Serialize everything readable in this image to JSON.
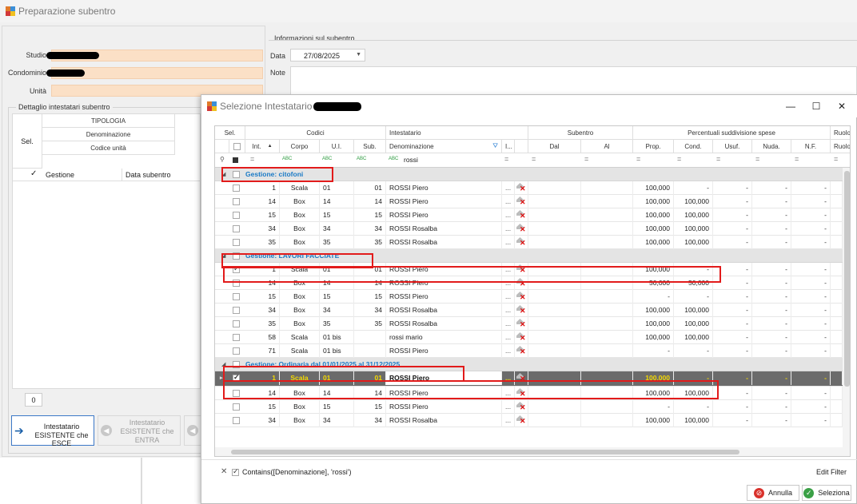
{
  "parent": {
    "title": "Preparazione subentro",
    "labels": {
      "studio": "Studio",
      "condominio": "Condominio",
      "unita": "Unità"
    },
    "info": {
      "section_title": "Informazioni sul subentro",
      "data_label": "Data",
      "data_value": "27/08/2025",
      "note_label": "Note"
    },
    "dettaglio": {
      "section_title": "Dettaglio intestatari subentro",
      "sel_header": "Sel.",
      "sub_headers": [
        "TIPOLOGIA",
        "Denominazione",
        "Codice unità"
      ],
      "col_gestione": "Gestione",
      "col_data_subentro": "Data subentro",
      "count": "0"
    },
    "buttons": {
      "esce_line1": "Intestatario",
      "esce_line2": "ESISTENTE che ESCE",
      "entra_line1": "Intestatario",
      "entra_line2": "ESISTENTE che",
      "entra_line3": "ENTRA"
    }
  },
  "modal": {
    "title": "Selezione Intestatario",
    "window_buttons": {
      "minimize": "—",
      "maximize": "☐",
      "close": "✕"
    },
    "bands": {
      "sel": "Sel.",
      "codici": "Codici",
      "intestatario": "Intestatario",
      "subentro": "Subentro",
      "percentuali": "Percentuali suddivisione spese",
      "ruolo": "Ruolo"
    },
    "columns": {
      "int": "Int.",
      "corpo": "Corpo",
      "ui": "U.I.",
      "sub": "Sub.",
      "denominazione": "Denominazione",
      "i": "I...",
      "dal": "Dal",
      "al": "Al",
      "prop": "Prop.",
      "cond": "Cond.",
      "usuf": "Usuf.",
      "nuda": "Nuda.",
      "nf": "N.F.",
      "ruolo": "Ruolo"
    },
    "filter_row": {
      "eq": "=",
      "abc": "ABC",
      "denominazione_filter": "rossi"
    },
    "groups": [
      {
        "title": "Gestione: citofoni",
        "rows": [
          {
            "int": "1",
            "corpo": "Scala",
            "ui": "01",
            "sub": "01",
            "den": "ROSSI Piero",
            "prop": "100,000",
            "cond": "-",
            "usuf": "-",
            "nuda": "-",
            "nf": "-",
            "checked": false
          },
          {
            "int": "14",
            "corpo": "Box",
            "ui": "14",
            "sub": "14",
            "den": "ROSSI Piero",
            "prop": "100,000",
            "cond": "100,000",
            "usuf": "-",
            "nuda": "-",
            "nf": "-",
            "checked": false
          },
          {
            "int": "15",
            "corpo": "Box",
            "ui": "15",
            "sub": "15",
            "den": "ROSSI Piero",
            "prop": "100,000",
            "cond": "100,000",
            "usuf": "-",
            "nuda": "-",
            "nf": "-",
            "checked": false
          },
          {
            "int": "34",
            "corpo": "Box",
            "ui": "34",
            "sub": "34",
            "den": "ROSSI Rosalba",
            "prop": "100,000",
            "cond": "100,000",
            "usuf": "-",
            "nuda": "-",
            "nf": "-",
            "checked": false
          },
          {
            "int": "35",
            "corpo": "Box",
            "ui": "35",
            "sub": "35",
            "den": "ROSSI Rosalba",
            "prop": "100,000",
            "cond": "100,000",
            "usuf": "-",
            "nuda": "-",
            "nf": "-",
            "checked": false
          }
        ]
      },
      {
        "title": "Gestione: LAVORI FACCIATE",
        "rows": [
          {
            "int": "1",
            "corpo": "Scala",
            "ui": "01",
            "sub": "01",
            "den": "ROSSI Piero",
            "prop": "100,000",
            "cond": "-",
            "usuf": "-",
            "nuda": "-",
            "nf": "-",
            "checked": true
          },
          {
            "int": "14",
            "corpo": "Box",
            "ui": "14",
            "sub": "14",
            "den": "ROSSI Piero",
            "prop": "50,000",
            "cond": "50,000",
            "usuf": "-",
            "nuda": "-",
            "nf": "-",
            "checked": false
          },
          {
            "int": "15",
            "corpo": "Box",
            "ui": "15",
            "sub": "15",
            "den": "ROSSI Piero",
            "prop": "-",
            "cond": "-",
            "usuf": "-",
            "nuda": "-",
            "nf": "-",
            "checked": false
          },
          {
            "int": "34",
            "corpo": "Box",
            "ui": "34",
            "sub": "34",
            "den": "ROSSI Rosalba",
            "prop": "100,000",
            "cond": "100,000",
            "usuf": "-",
            "nuda": "-",
            "nf": "-",
            "checked": false
          },
          {
            "int": "35",
            "corpo": "Box",
            "ui": "35",
            "sub": "35",
            "den": "ROSSI Rosalba",
            "prop": "100,000",
            "cond": "100,000",
            "usuf": "-",
            "nuda": "-",
            "nf": "-",
            "checked": false
          },
          {
            "int": "58",
            "corpo": "Scala",
            "ui": "01 bis",
            "sub": "",
            "den": "rossi mario",
            "prop": "100,000",
            "cond": "100,000",
            "usuf": "-",
            "nuda": "-",
            "nf": "-",
            "checked": false
          },
          {
            "int": "71",
            "corpo": "Scala",
            "ui": "01 bis",
            "sub": "",
            "den": "ROSSI Piero",
            "prop": "-",
            "cond": "-",
            "usuf": "-",
            "nuda": "-",
            "nf": "-",
            "checked": false
          }
        ]
      },
      {
        "title": "Gestione: Ordinaria dal 01/01/2025 al 31/12/2025",
        "rows": [
          {
            "int": "1",
            "corpo": "Scala",
            "ui": "01",
            "sub": "01",
            "den": "ROSSI Piero",
            "prop": "100,000",
            "cond": "-",
            "usuf": "-",
            "nuda": "-",
            "nf": "-",
            "checked": true,
            "selected": true
          },
          {
            "int": "14",
            "corpo": "Box",
            "ui": "14",
            "sub": "14",
            "den": "ROSSI Piero",
            "prop": "100,000",
            "cond": "100,000",
            "usuf": "-",
            "nuda": "-",
            "nf": "-",
            "checked": false
          },
          {
            "int": "15",
            "corpo": "Box",
            "ui": "15",
            "sub": "15",
            "den": "ROSSI Piero",
            "prop": "-",
            "cond": "-",
            "usuf": "-",
            "nuda": "-",
            "nf": "-",
            "checked": false
          },
          {
            "int": "34",
            "corpo": "Box",
            "ui": "34",
            "sub": "34",
            "den": "ROSSI Rosalba",
            "prop": "100,000",
            "cond": "100,000",
            "usuf": "-",
            "nuda": "-",
            "nf": "-",
            "checked": false
          }
        ]
      }
    ],
    "filter_expression": "Contains([Denominazione], 'rossi')",
    "edit_filter": "Edit Filter",
    "buttons": {
      "annulla": "Annulla",
      "seleziona": "Seleziona"
    },
    "colors": {
      "group_title": "#1a7ac6",
      "highlight": "#e21b1b",
      "selected_row": "#6b6b6b",
      "selected_text": "#f5d800"
    }
  }
}
